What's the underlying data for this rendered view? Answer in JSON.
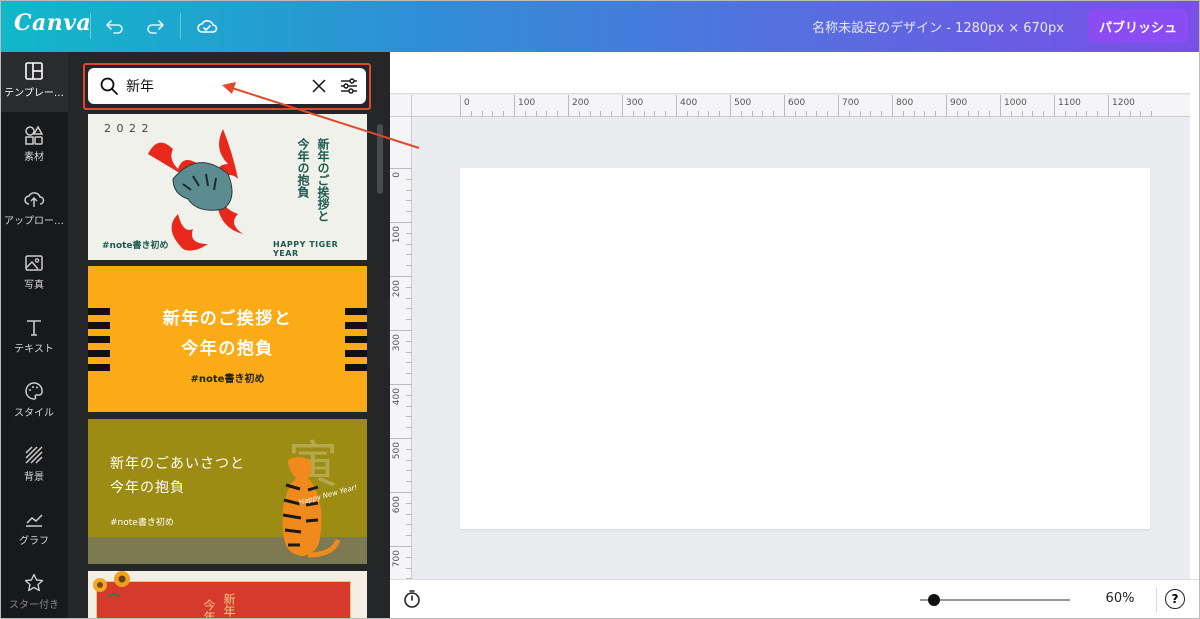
{
  "topbar": {
    "logo": "Canva",
    "doc_title": "名称未設定のデザイン - 1280px × 670px",
    "publish_label": "パブリッシュ",
    "icons": [
      "undo-icon",
      "redo-icon",
      "cloud-save-icon"
    ]
  },
  "rail": {
    "items": [
      {
        "label": "テンプレー…",
        "icon": "template-icon"
      },
      {
        "label": "素材",
        "icon": "elements-icon"
      },
      {
        "label": "アップロー…",
        "icon": "upload-icon"
      },
      {
        "label": "写真",
        "icon": "photo-icon"
      },
      {
        "label": "テキスト",
        "icon": "text-icon"
      },
      {
        "label": "スタイル",
        "icon": "palette-icon"
      },
      {
        "label": "背景",
        "icon": "background-icon"
      },
      {
        "label": "グラフ",
        "icon": "chart-icon"
      },
      {
        "label": "スター付き",
        "icon": "star-icon"
      }
    ]
  },
  "search": {
    "value": "新年",
    "placeholder": ""
  },
  "templates": {
    "card1": {
      "year": "2 0 2 2",
      "title_col1": "新年のご挨拶と",
      "title_col2": "今年の抱負",
      "tag": "#note書き初め",
      "footer": "HAPPY TIGER YEAR"
    },
    "card2": {
      "line1": "新年のご挨拶と",
      "line2": "今年の抱負",
      "tag": "#note書き初め"
    },
    "card3": {
      "line1": "新年のごあいさつと",
      "line2": "今年の抱負",
      "tag": "#note書き初め",
      "kanji": "寅",
      "script": "Happy New Year!"
    },
    "card4": {
      "col1": "今年",
      "col2": "新年"
    }
  },
  "ruler": {
    "h_labels": [
      "0",
      "100",
      "200",
      "300",
      "400",
      "500",
      "600",
      "700",
      "800",
      "900",
      "1000",
      "1100",
      "1200"
    ],
    "v_labels": [
      "0",
      "100",
      "200",
      "300",
      "400",
      "500",
      "600",
      "700"
    ]
  },
  "bottombar": {
    "zoom": "60%",
    "help": "?"
  },
  "colors": {
    "accent_purple": "#8a4cf3",
    "highlight_red": "#e04a2c",
    "card2_orange": "#fbab16",
    "card3_olive": "#9d8c13"
  }
}
